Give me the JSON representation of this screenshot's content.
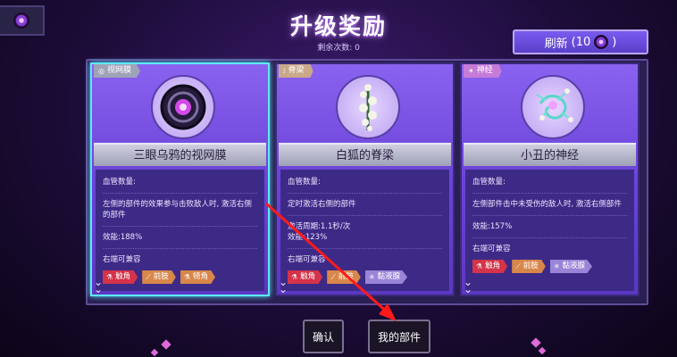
{
  "title": "升级奖励",
  "subtitle": "剩余次数: 0",
  "refresh": {
    "label": "刷新",
    "cost_open": "(10",
    "cost_close": ")"
  },
  "cards": [
    {
      "tag": "视网膜",
      "tag_color": "#9fa3b8",
      "name": "三眼乌鸦的视网膜",
      "vessel_label": "血管数量:",
      "desc": "左侧的部件的效果参与击败敌人时, 激活右侧的部件",
      "stat": "效能:188%",
      "compat_label": "右端可兼容",
      "pills": [
        {
          "label": "触角",
          "color": "red"
        },
        {
          "label": "前肢",
          "color": "orange"
        },
        {
          "label": "犄角",
          "color": "orange"
        }
      ]
    },
    {
      "tag": "脊梁",
      "tag_color": "#c9a98a",
      "name": "白狐的脊梁",
      "vessel_label": "血管数量:",
      "desc": "定时激活右侧的部件",
      "stat_line1": "激活周期:1.1秒/次",
      "stat": "效能:123%",
      "compat_label": "右端可兼容",
      "pills": [
        {
          "label": "触角",
          "color": "red"
        },
        {
          "label": "前肢",
          "color": "orange"
        },
        {
          "label": "黏液腺",
          "color": "purple"
        }
      ]
    },
    {
      "tag": "神经",
      "tag_color": "#c67bd8",
      "name": "小丑的神经",
      "vessel_label": "血管数量:",
      "desc": "左侧部件击中未受伤的敌人时, 激活右侧部件",
      "stat": "效能:157%",
      "compat_label": "右端可兼容",
      "pills": [
        {
          "label": "触角",
          "color": "red"
        },
        {
          "label": "前肢",
          "color": "orange"
        },
        {
          "label": "黏液腺",
          "color": "purple"
        }
      ]
    }
  ],
  "buttons": {
    "confirm": "确认",
    "my_parts": "我的部件"
  }
}
